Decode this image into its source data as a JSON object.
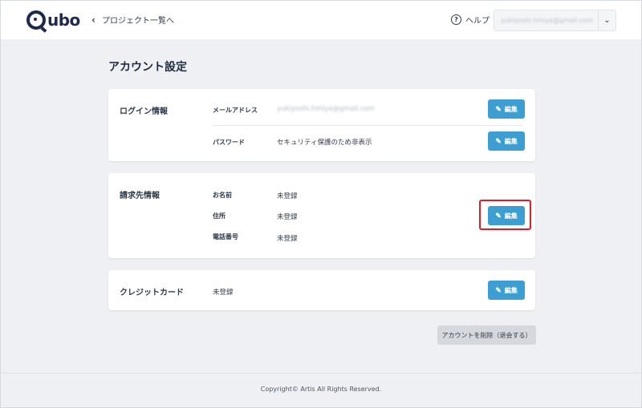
{
  "header": {
    "logo_text": "ubo",
    "back_label": "プロジェクト一覧へ",
    "help_label": "ヘルプ",
    "account_email": "yukiyoshi.hmiya@gmail.com"
  },
  "page": {
    "title": "アカウント設定"
  },
  "login_card": {
    "label": "ログイン情報",
    "email_label": "メールアドレス",
    "email_value": "yukiyoshi.hmiya@gmail.com",
    "password_label": "パスワード",
    "password_value": "セキュリティ保護のため非表示",
    "edit_label": "編集"
  },
  "billing_card": {
    "label": "請求先情報",
    "name_label": "お名前",
    "name_value": "未登録",
    "address_label": "住所",
    "address_value": "未登録",
    "phone_label": "電話番号",
    "phone_value": "未登録",
    "edit_label": "編集"
  },
  "credit_card": {
    "label": "クレジットカード",
    "value": "未登録",
    "edit_label": "編集"
  },
  "delete_button": {
    "label": "アカウントを削除（退会する）"
  },
  "footer": {
    "copyright": "Copyright© Artis All Rights Reserved."
  },
  "colors": {
    "accent": "#3d9ed1",
    "highlight": "#e21b24",
    "background": "#eef0f3"
  },
  "icons": {
    "pen": "pencil-icon",
    "back": "chevron-left-icon",
    "help": "question-circle-icon",
    "dropdown": "chevron-down-icon"
  }
}
